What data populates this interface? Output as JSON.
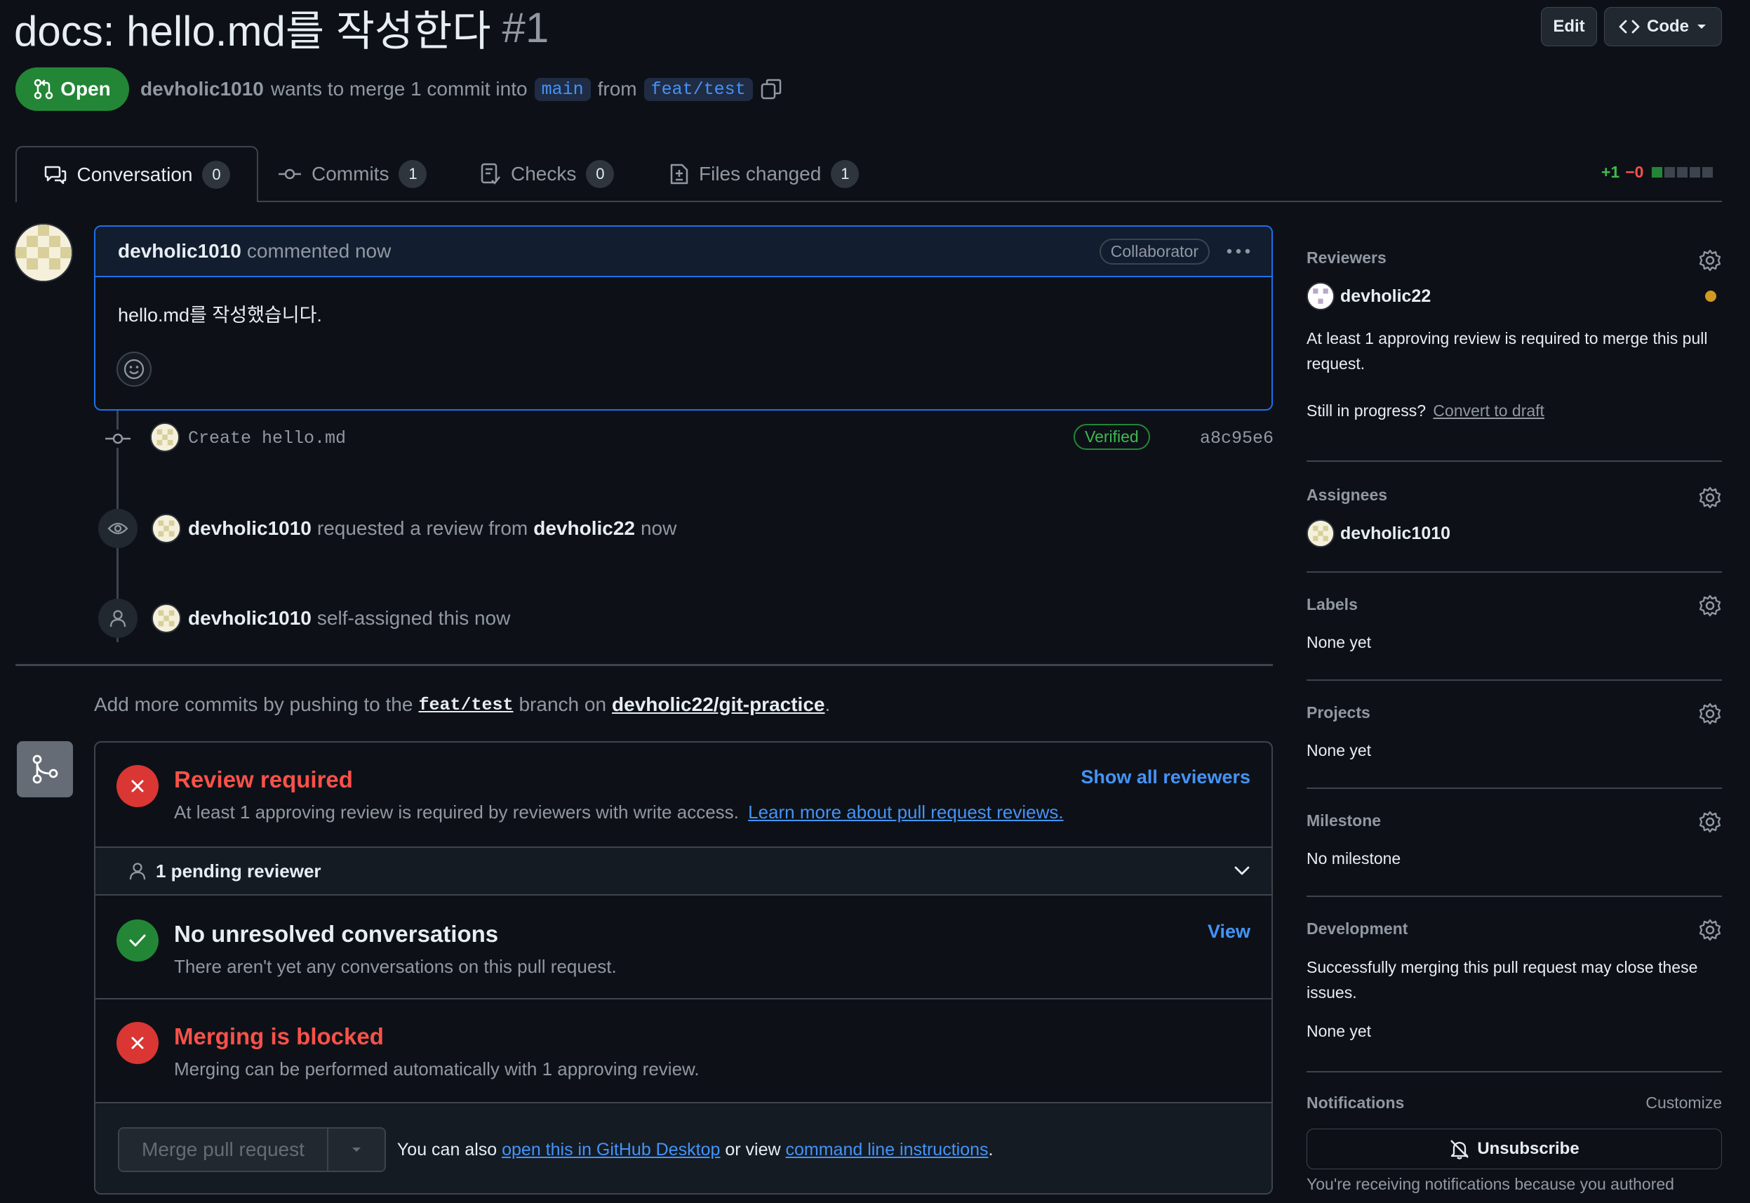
{
  "pr": {
    "title": "docs: hello.md를 작성한다",
    "number": "#1",
    "state": "Open",
    "author": "devholic1010",
    "merge_text": "wants to merge 1 commit into",
    "base_branch": "main",
    "from_text": "from",
    "head_branch": "feat/test"
  },
  "header_actions": {
    "edit": "Edit",
    "code": "Code"
  },
  "tabs": [
    {
      "label": "Conversation",
      "count": "0"
    },
    {
      "label": "Commits",
      "count": "1"
    },
    {
      "label": "Checks",
      "count": "0"
    },
    {
      "label": "Files changed",
      "count": "1"
    }
  ],
  "diffstat": {
    "added": "+1",
    "removed": "−0"
  },
  "comment": {
    "author": "devholic1010",
    "action": "commented now",
    "badge": "Collaborator",
    "body": "hello.md를 작성했습니다."
  },
  "timeline": {
    "commit_message": "Create hello.md",
    "verified": "Verified",
    "sha": "a8c95e6",
    "review_actor": "devholic1010",
    "review_text": "requested a review from",
    "review_target": "devholic22",
    "review_time": "now",
    "assign_actor": "devholic1010",
    "assign_text": "self-assigned this now"
  },
  "push_hint": {
    "prefix": "Add more commits by pushing to the",
    "branch": "feat/test",
    "middle": "branch on",
    "repo": "devholic22/git-practice",
    "suffix": "."
  },
  "merge_box": {
    "review_required_title": "Review required",
    "review_required_desc": "At least 1 approving review is required by reviewers with write access.",
    "review_required_link": "Learn more about pull request reviews.",
    "show_all_reviewers": "Show all reviewers",
    "pending_reviewer": "1 pending reviewer",
    "conversations_title": "No unresolved conversations",
    "conversations_desc": "There aren't yet any conversations on this pull request.",
    "view_link": "View",
    "blocked_title": "Merging is blocked",
    "blocked_desc": "Merging can be performed automatically with 1 approving review.",
    "merge_button": "Merge pull request",
    "also_text": "You can also",
    "desktop_link": "open this in GitHub Desktop",
    "or_view": "or view",
    "cli_link": "command line instructions",
    "period": "."
  },
  "sidebar": {
    "reviewers_label": "Reviewers",
    "reviewer_name": "devholic22",
    "reviewer_note": "At least 1 approving review is required to merge this pull request.",
    "in_progress": "Still in progress?",
    "convert_draft": "Convert to draft",
    "assignees_label": "Assignees",
    "assignee_name": "devholic1010",
    "labels_label": "Labels",
    "labels_value": "None yet",
    "projects_label": "Projects",
    "projects_value": "None yet",
    "milestone_label": "Milestone",
    "milestone_value": "No milestone",
    "development_label": "Development",
    "development_note": "Successfully merging this pull request may close these issues.",
    "development_value": "None yet",
    "notifications_label": "Notifications",
    "customize": "Customize",
    "unsubscribe": "Unsubscribe",
    "notifications_note": "You're receiving notifications because you authored"
  },
  "colors": {
    "open_green": "#238636",
    "danger": "#da3633",
    "danger_text": "#f85149",
    "success": "#238636",
    "link": "#4493f8",
    "pending_dot": "#d29922"
  }
}
